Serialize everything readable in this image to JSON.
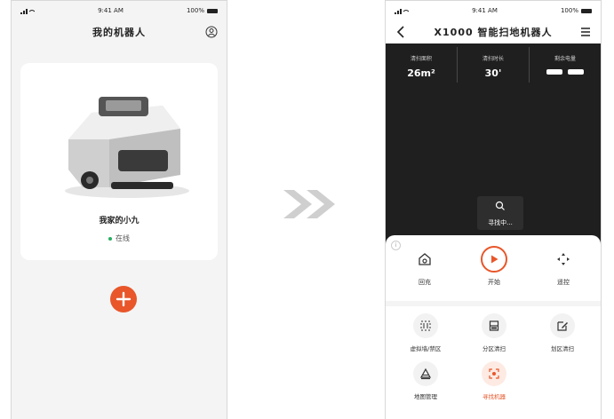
{
  "left": {
    "status": {
      "time": "9:41 AM",
      "battery": "100%"
    },
    "title": "我的机器人",
    "robot": {
      "name": "我家的小九",
      "status": "在线"
    }
  },
  "right": {
    "status": {
      "time": "9:41 AM",
      "battery": "100%"
    },
    "title": "X1000 智能扫地机器人",
    "stats": [
      {
        "label": "清扫面积",
        "value": "26m²"
      },
      {
        "label": "清扫时长",
        "value": "30'"
      },
      {
        "label": "剩余电量",
        "value": ""
      }
    ],
    "tooltip": "寻找中...",
    "controls": {
      "recharge": "回充",
      "start": "开始",
      "remote": "遥控"
    },
    "features": [
      {
        "label": "虚拟墙/禁区",
        "icon": "virtual-wall-icon"
      },
      {
        "label": "分区清扫",
        "icon": "zone-clean-icon"
      },
      {
        "label": "划区清扫",
        "icon": "edit-area-icon"
      },
      {
        "label": "地图管理",
        "icon": "map-manage-icon"
      },
      {
        "label": "寻找机器",
        "icon": "locate-robot-icon",
        "active": true
      }
    ]
  },
  "colors": {
    "accent": "#e8562a",
    "online": "#27ae60",
    "map_bg": "#1f1f1f"
  }
}
